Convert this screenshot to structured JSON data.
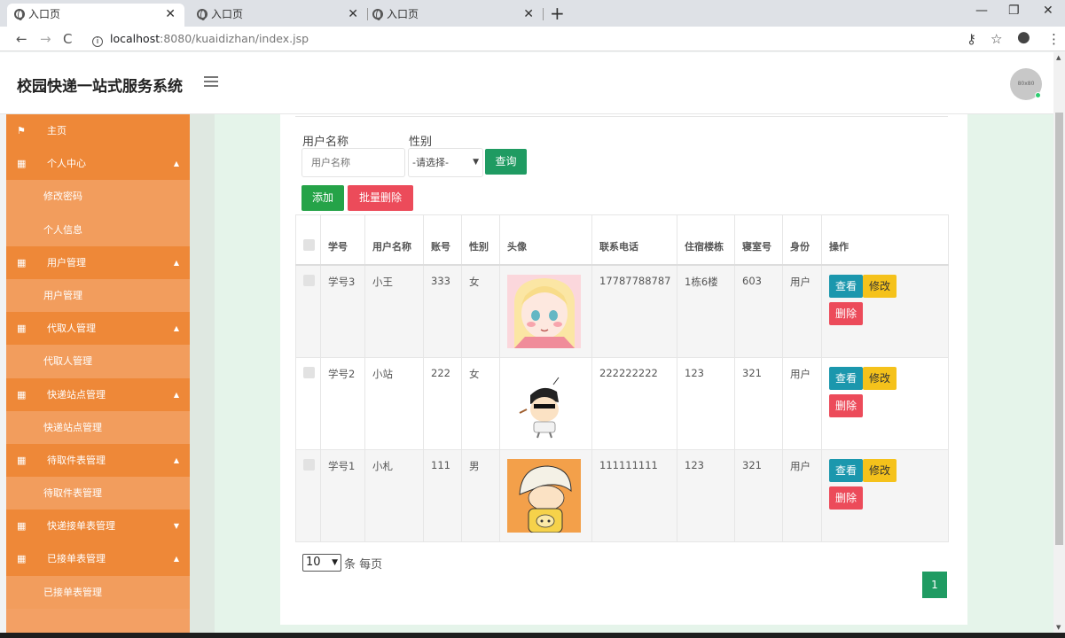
{
  "browser": {
    "tabs": [
      {
        "title": "入口页",
        "active": true
      },
      {
        "title": "入口页",
        "active": false
      },
      {
        "title": "入口页",
        "active": false
      }
    ],
    "url_host": "localhost",
    "url_rest": ":8080/kuaidizhan/index.jsp"
  },
  "header": {
    "title": "校园快递一站式服务系统",
    "avatar_text": "80x80"
  },
  "sidebar": {
    "home": "主页",
    "groups": [
      {
        "label": "个人中心",
        "expanded": true,
        "items": [
          "修改密码",
          "个人信息"
        ]
      },
      {
        "label": "用户管理",
        "expanded": true,
        "items": [
          "用户管理"
        ]
      },
      {
        "label": "代取人管理",
        "expanded": true,
        "items": [
          "代取人管理"
        ]
      },
      {
        "label": "快递站点管理",
        "expanded": true,
        "items": [
          "快递站点管理"
        ]
      },
      {
        "label": "待取件表管理",
        "expanded": true,
        "items": [
          "待取件表管理"
        ]
      },
      {
        "label": "快递接单表管理",
        "expanded": false,
        "items": []
      },
      {
        "label": "已接单表管理",
        "expanded": true,
        "items": [
          "已接单表管理"
        ]
      }
    ]
  },
  "search": {
    "name_label": "用户名称",
    "name_placeholder": "用户名称",
    "gender_label": "性别",
    "gender_selected": "-请选择-",
    "query_button": "查询"
  },
  "actions": {
    "add": "添加",
    "bulk_delete": "批量删除"
  },
  "table": {
    "headers": [
      "学号",
      "用户名称",
      "账号",
      "性别",
      "头像",
      "联系电话",
      "住宿楼栋",
      "寝室号",
      "身份",
      "操作"
    ],
    "rows": [
      {
        "student_id": "学号3",
        "name": "小王",
        "account": "333",
        "gender": "女",
        "phone": "17787788787",
        "building": "1栋6楼",
        "room": "603",
        "role": "用户"
      },
      {
        "student_id": "学号2",
        "name": "小站",
        "account": "222",
        "gender": "女",
        "phone": "222222222",
        "building": "123",
        "room": "321",
        "role": "用户"
      },
      {
        "student_id": "学号1",
        "name": "小札",
        "account": "111",
        "gender": "男",
        "phone": "111111111",
        "building": "123",
        "room": "321",
        "role": "用户"
      }
    ],
    "op_view": "查看",
    "op_edit": "修改",
    "op_delete": "删除"
  },
  "pagination": {
    "page_size": "10",
    "page_size_suffix": "条 每页",
    "current_page": "1"
  }
}
